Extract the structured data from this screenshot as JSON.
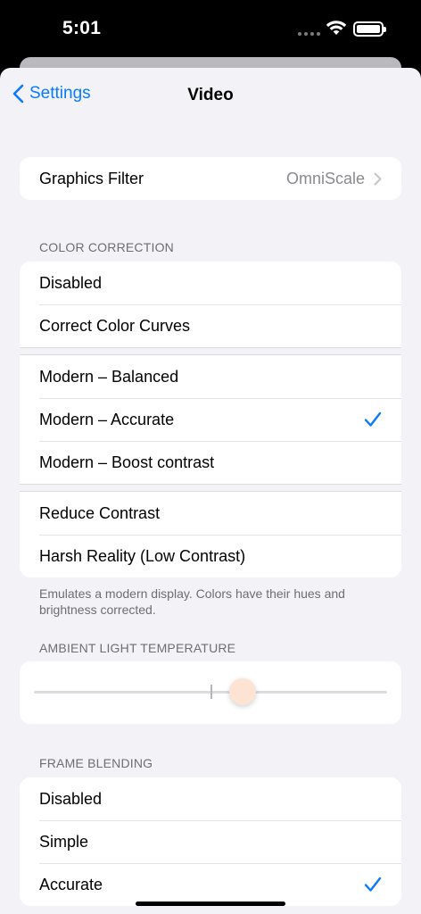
{
  "status_bar": {
    "time": "5:01"
  },
  "nav": {
    "back_label": "Settings",
    "title": "Video"
  },
  "graphics_filter": {
    "label": "Graphics Filter",
    "value": "OmniScale"
  },
  "color_correction": {
    "header": "COLOR CORRECTION",
    "options_group1": [
      "Disabled",
      "Correct Color Curves"
    ],
    "options_group2": [
      "Modern – Balanced",
      "Modern – Accurate",
      "Modern – Boost contrast"
    ],
    "options_group3": [
      "Reduce Contrast",
      "Harsh Reality (Low Contrast)"
    ],
    "selected": "Modern – Accurate",
    "footer": "Emulates a modern display. Colors have their hues and brightness corrected."
  },
  "ambient_light": {
    "header": "AMBIENT LIGHT TEMPERATURE",
    "slider_value_fraction": 0.59,
    "thumb_color": "#fde3d4"
  },
  "frame_blending": {
    "header": "FRAME BLENDING",
    "options": [
      "Disabled",
      "Simple",
      "Accurate"
    ],
    "selected": "Accurate"
  },
  "colors": {
    "accent": "#0a7aff",
    "background": "#f2f2f7",
    "secondary_text": "#6d6d72"
  },
  "icons": [
    "chevron-left-icon",
    "chevron-right-icon",
    "checkmark-icon",
    "wifi-icon",
    "battery-icon"
  ]
}
